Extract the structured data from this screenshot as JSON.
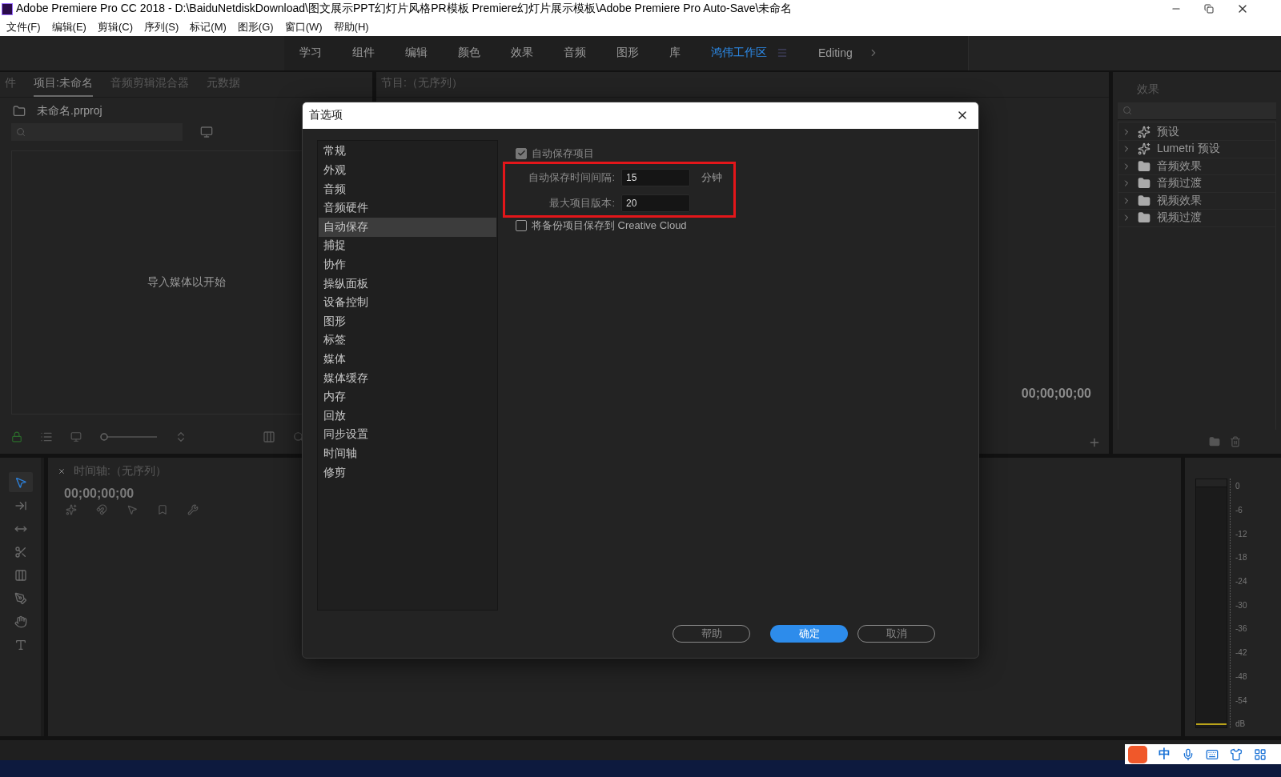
{
  "window": {
    "title": "Adobe Premiere Pro CC 2018 - D:\\BaiduNetdiskDownload\\图文展示PPT幻灯片风格PR模板 Premiere幻灯片展示模板\\Adobe Premiere Pro Auto-Save\\未命名"
  },
  "menu": [
    "文件(F)",
    "编辑(E)",
    "剪辑(C)",
    "序列(S)",
    "标记(M)",
    "图形(G)",
    "窗口(W)",
    "帮助(H)"
  ],
  "workspaces": [
    {
      "label": "学习",
      "selected": false
    },
    {
      "label": "组件",
      "selected": false
    },
    {
      "label": "编辑",
      "selected": false
    },
    {
      "label": "颜色",
      "selected": false
    },
    {
      "label": "效果",
      "selected": false
    },
    {
      "label": "音频",
      "selected": false
    },
    {
      "label": "图形",
      "selected": false
    },
    {
      "label": "库",
      "selected": false
    },
    {
      "label": "鸿伟工作区",
      "selected": true
    },
    {
      "label": "Editing",
      "selected": false
    }
  ],
  "project_panel": {
    "tabs": [
      {
        "label": "件",
        "selected": false
      },
      {
        "label": "项目:未命名",
        "selected": true
      },
      {
        "label": "音频剪辑混合器",
        "selected": false
      },
      {
        "label": "元数据",
        "selected": false
      }
    ],
    "file": "未命名.prproj",
    "empty_text": "导入媒体以开始",
    "zoom": {
      "level": 0
    }
  },
  "program_panel": {
    "title": "节目:（无序列）",
    "timecode": "00;00;00;00"
  },
  "effects_panel": {
    "title": "效果",
    "items": [
      {
        "label": "预设",
        "kind": "preset",
        "expanded": false
      },
      {
        "label": "Lumetri 预设",
        "kind": "preset",
        "expanded": false
      },
      {
        "label": "音频效果",
        "kind": "folder",
        "expanded": false
      },
      {
        "label": "音频过渡",
        "kind": "folder",
        "expanded": false
      },
      {
        "label": "视频效果",
        "kind": "folder",
        "expanded": false
      },
      {
        "label": "视频过渡",
        "kind": "folder",
        "expanded": false
      }
    ]
  },
  "tools": [
    {
      "kind": "select",
      "selected": true
    },
    {
      "kind": "track",
      "selected": false
    },
    {
      "kind": "ripple",
      "selected": false
    },
    {
      "kind": "razor",
      "selected": false
    },
    {
      "kind": "slip",
      "selected": false
    },
    {
      "kind": "pen",
      "selected": false
    },
    {
      "kind": "hand",
      "selected": false
    },
    {
      "kind": "type",
      "selected": false
    }
  ],
  "timeline_panel": {
    "title": "时间轴:（无序列）",
    "timecode": "00;00;00;00"
  },
  "meter": {
    "scale": [
      "0",
      "-6",
      "-12",
      "-18",
      "-24",
      "-30",
      "-36",
      "-42",
      "-48",
      "-54",
      "dB"
    ]
  },
  "dialog": {
    "title": "首选项",
    "categories": [
      {
        "label": "常规",
        "selected": false
      },
      {
        "label": "外观",
        "selected": false
      },
      {
        "label": "音频",
        "selected": false
      },
      {
        "label": "音频硬件",
        "selected": false
      },
      {
        "label": "自动保存",
        "selected": true
      },
      {
        "label": "捕捉",
        "selected": false
      },
      {
        "label": "协作",
        "selected": false
      },
      {
        "label": "操纵面板",
        "selected": false
      },
      {
        "label": "设备控制",
        "selected": false
      },
      {
        "label": "图形",
        "selected": false
      },
      {
        "label": "标签",
        "selected": false
      },
      {
        "label": "媒体",
        "selected": false
      },
      {
        "label": "媒体缓存",
        "selected": false
      },
      {
        "label": "内存",
        "selected": false
      },
      {
        "label": "回放",
        "selected": false
      },
      {
        "label": "同步设置",
        "selected": false
      },
      {
        "label": "时间轴",
        "selected": false
      },
      {
        "label": "修剪",
        "selected": false
      }
    ],
    "autosave": {
      "label": "自动保存项目",
      "checked": true
    },
    "fields": [
      {
        "label": "自动保存时间间隔:",
        "value": "15",
        "unit": "分钟"
      },
      {
        "label": "最大项目版本:",
        "value": "20"
      }
    ],
    "cloud_backup": {
      "label": "将备份项目保存到 Creative Cloud",
      "checked": false
    },
    "buttons": [
      {
        "label": "帮助",
        "kind": "secondary"
      },
      {
        "label": "确定",
        "kind": "primary"
      },
      {
        "label": "取消",
        "kind": "secondary"
      }
    ]
  },
  "ime": {
    "mode": "中"
  }
}
